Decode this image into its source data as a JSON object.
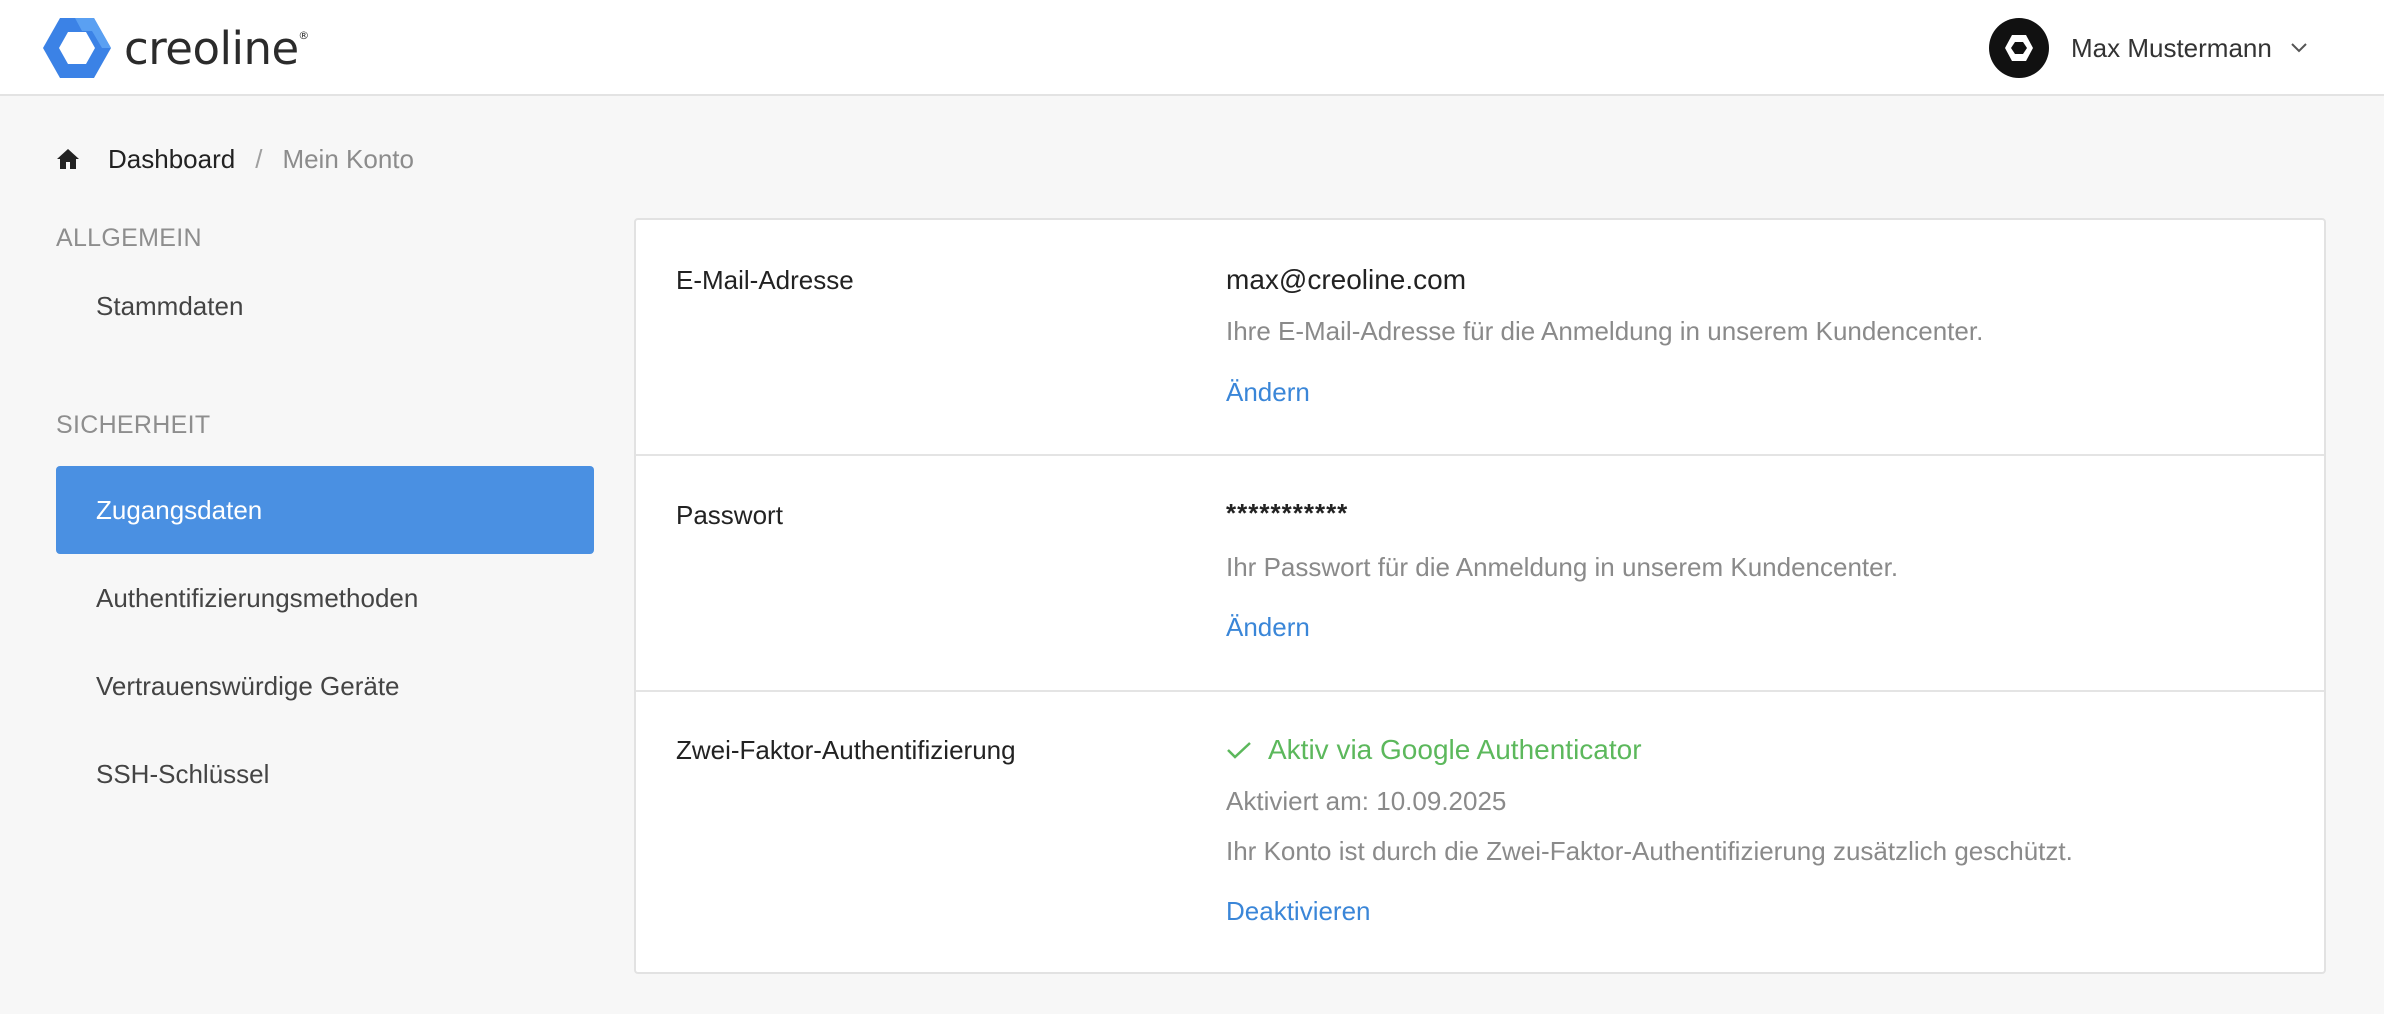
{
  "header": {
    "brand_name": "creoline",
    "brand_reg": "®",
    "user_name": "Max Mustermann",
    "icons": {
      "logo": "hexagon-logo-icon",
      "avatar": "hexagon-avatar-icon",
      "user_menu": "chevron-down-icon"
    }
  },
  "breadcrumb": {
    "home_icon": "home-icon",
    "dashboard": "Dashboard",
    "separator": "/",
    "current": "Mein Konto"
  },
  "sidebar": {
    "sections": [
      {
        "title": "ALLGEMEIN",
        "items": [
          {
            "label": "Stammdaten",
            "active": false
          }
        ]
      },
      {
        "title": "SICHERHEIT",
        "items": [
          {
            "label": "Zugangsdaten",
            "active": true
          },
          {
            "label": "Authentifizierungsmethoden",
            "active": false
          },
          {
            "label": "Vertrauenswürdige Geräte",
            "active": false
          },
          {
            "label": "SSH-Schlüssel",
            "active": false
          }
        ]
      }
    ]
  },
  "main": {
    "email": {
      "label": "E-Mail-Adresse",
      "value": "max@creoline.com",
      "description": "Ihre E-Mail-Adresse für die Anmeldung in unserem Kundencenter.",
      "action": "Ändern"
    },
    "password": {
      "label": "Passwort",
      "value": "***********",
      "description": "Ihr Passwort für die Anmeldung in unserem Kundencenter.",
      "action": "Ändern"
    },
    "two_factor": {
      "label": "Zwei-Faktor-Authentifizierung",
      "status": "Aktiv via Google Authenticator",
      "status_icon": "checkmark-icon",
      "activated": "Aktiviert am: 10.09.2025",
      "description": "Ihr Konto ist durch die Zwei-Faktor-Authentifizierung zusätzlich geschützt.",
      "action": "Deaktivieren"
    }
  },
  "colors": {
    "accent": "#4a90e2",
    "link": "#3a86d8",
    "success": "#5cb85c",
    "muted_text": "#8a8a8a",
    "background": "#f7f7f7"
  }
}
